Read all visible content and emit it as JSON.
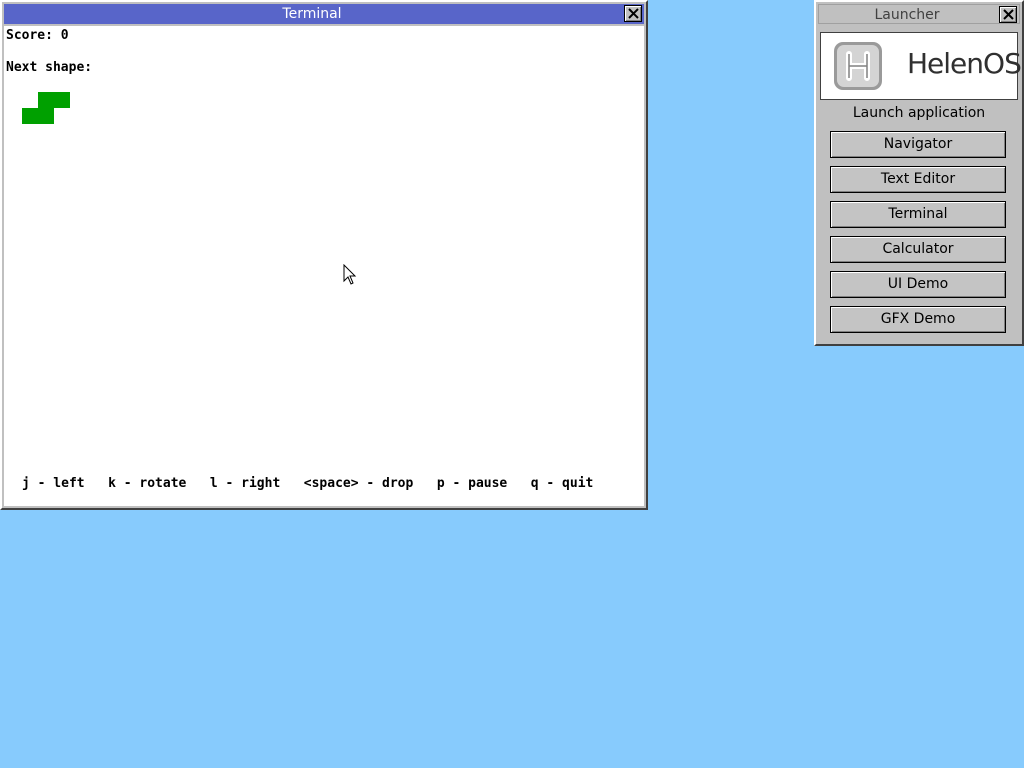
{
  "terminal": {
    "title": "Terminal",
    "score_line": "Score: 0",
    "next_label": "Next shape:",
    "help_line": "j - left   k - rotate   l - right   <space> - drop   p - pause   q - quit",
    "shape_color": "#00a000"
  },
  "launcher": {
    "title": "Launcher",
    "logo_text": "HelenOS",
    "heading": "Launch application",
    "buttons": [
      "Navigator",
      "Text Editor",
      "Terminal",
      "Calculator",
      "UI Demo",
      "GFX Demo"
    ]
  },
  "colors": {
    "desktop": "#87cbfd",
    "active_titlebar": "#5865c9"
  },
  "icons": {
    "close": "close-icon",
    "cursor": "mouse-pointer-icon"
  }
}
